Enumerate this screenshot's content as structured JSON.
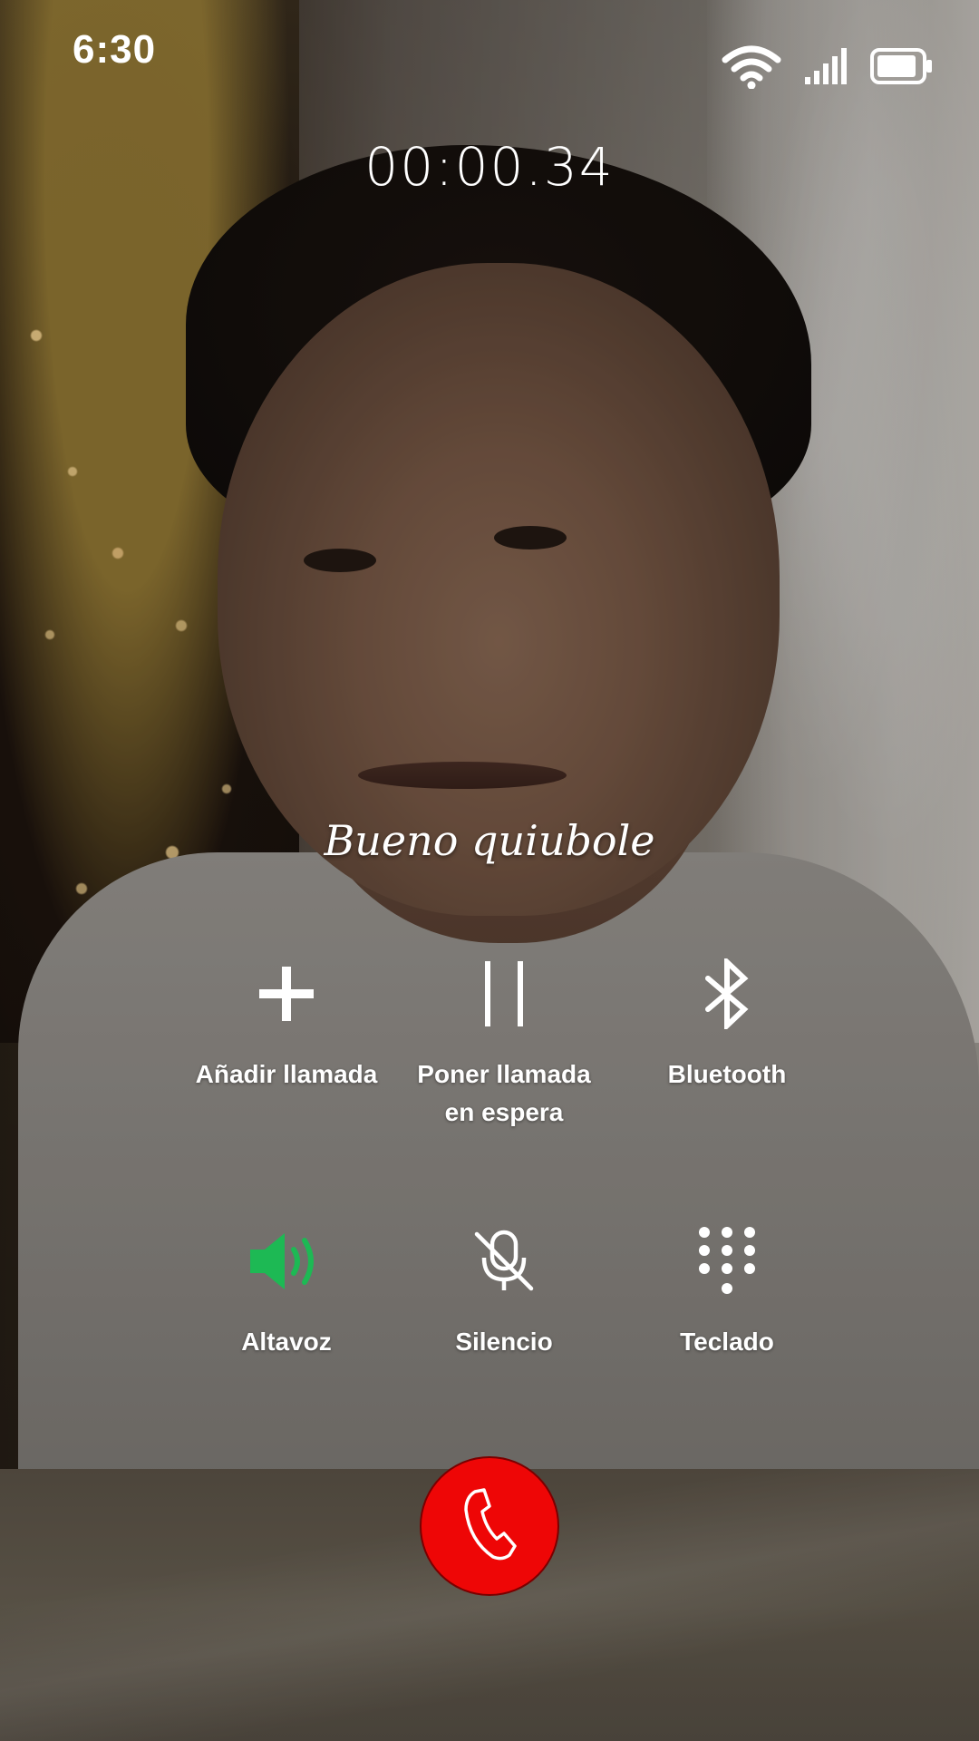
{
  "status_bar": {
    "time": "6:30",
    "icons": [
      "wifi-icon",
      "cellular-signal-icon",
      "battery-icon"
    ]
  },
  "call": {
    "timer": "00:00.34",
    "caption": "Bueno quiubole"
  },
  "controls": [
    {
      "name": "add-call",
      "icon": "plus-icon",
      "label": "Añadir llamada"
    },
    {
      "name": "hold-call",
      "icon": "pause-icon",
      "label": "Poner llamada en espera"
    },
    {
      "name": "bluetooth",
      "icon": "bluetooth-icon",
      "label": "Bluetooth"
    },
    {
      "name": "speaker",
      "icon": "speaker-icon",
      "label": "Altavoz",
      "active": true
    },
    {
      "name": "mute",
      "icon": "mic-off-icon",
      "label": "Silencio"
    },
    {
      "name": "keypad",
      "icon": "keypad-icon",
      "label": "Teclado"
    }
  ],
  "end_call": {
    "icon": "phone-icon"
  },
  "colors": {
    "speaker_active": "#1db954",
    "end_call": "#ee0606",
    "text": "#ffffff"
  }
}
